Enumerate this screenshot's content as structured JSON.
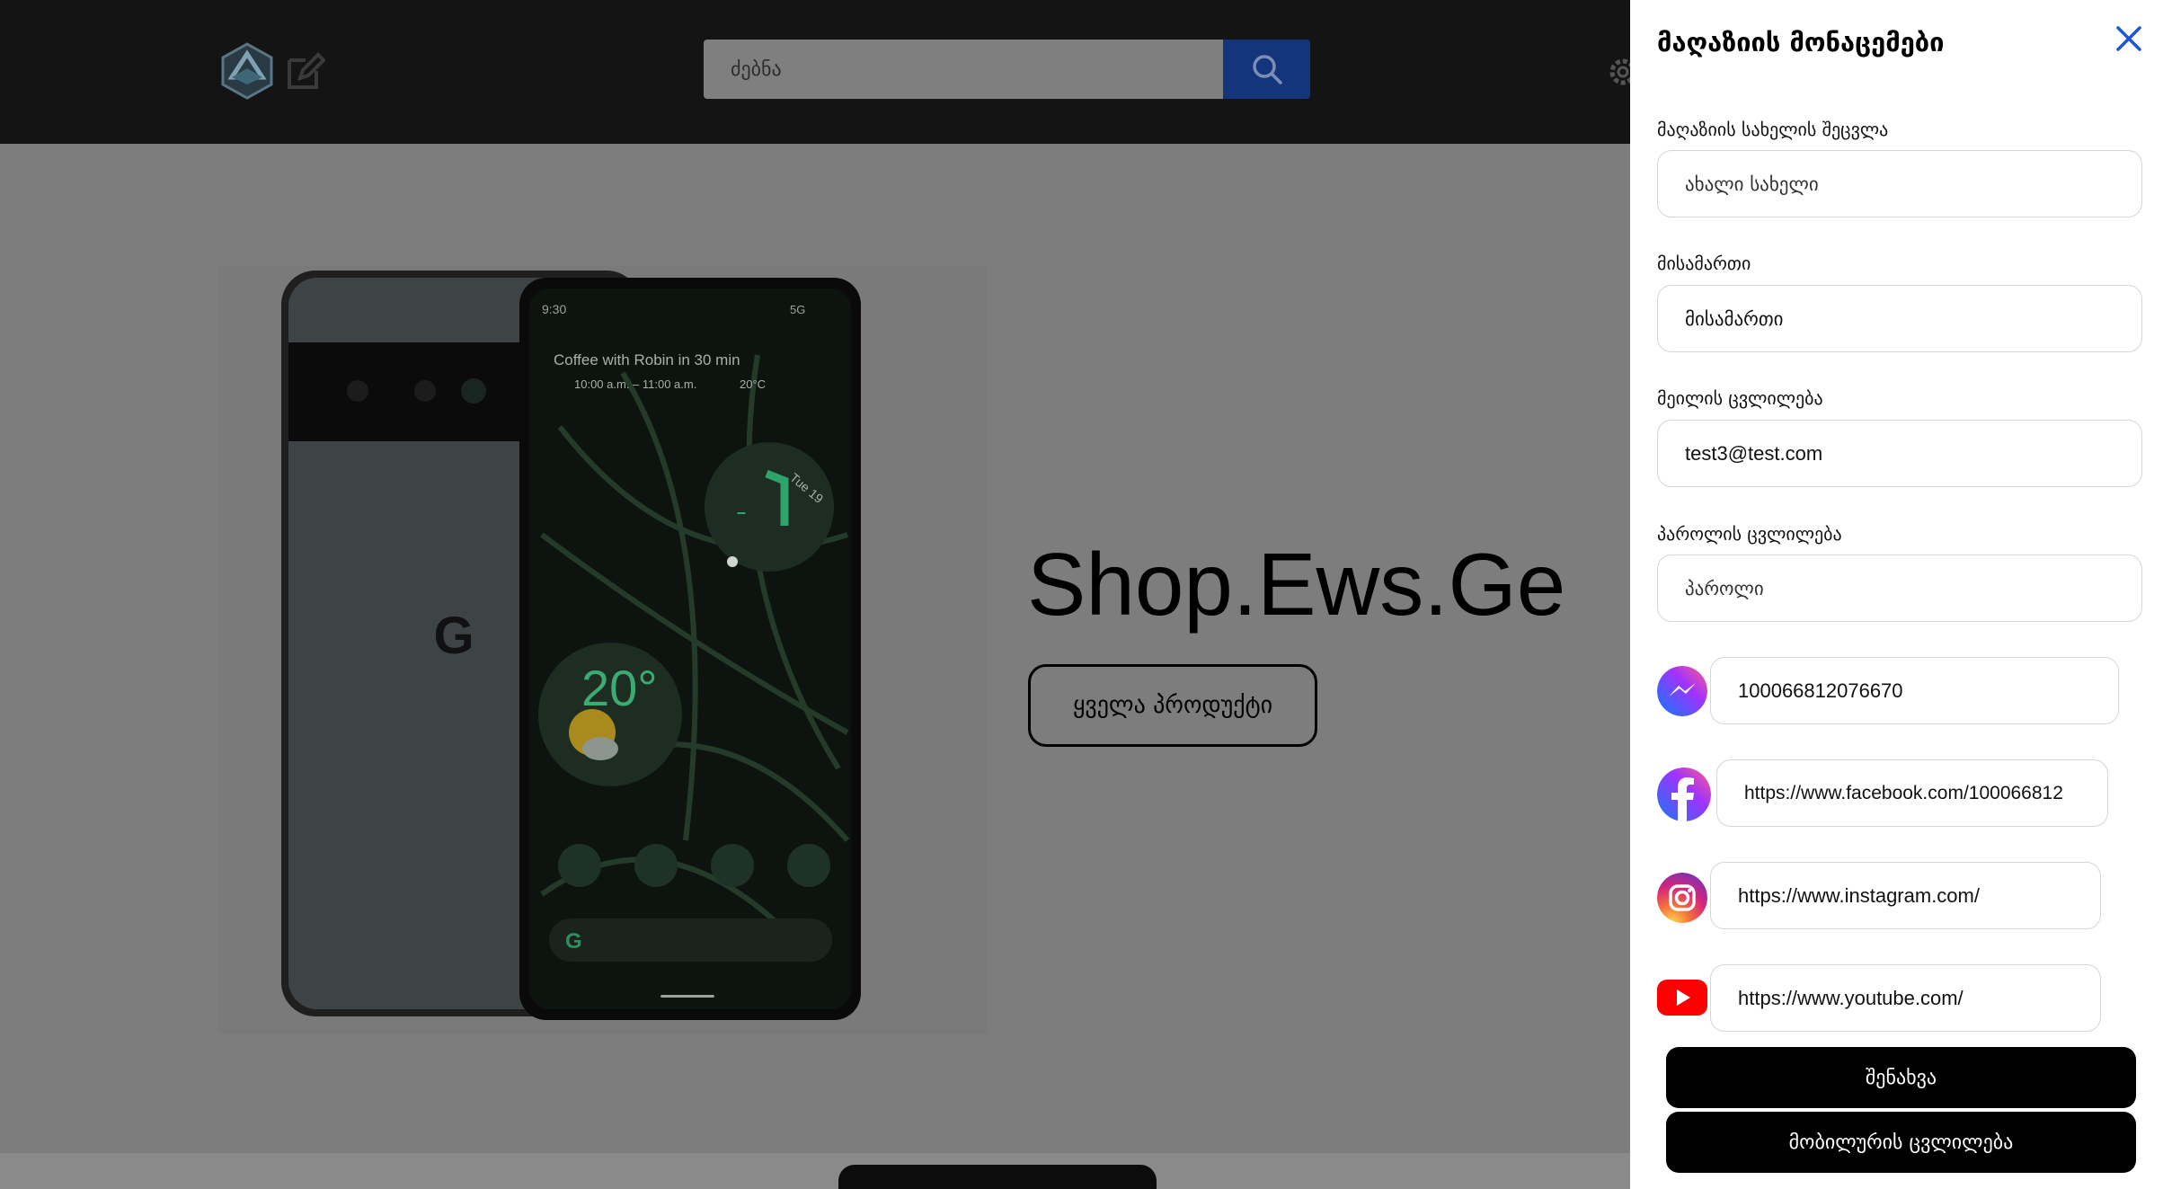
{
  "header": {
    "search_placeholder": "ძებნა"
  },
  "hero": {
    "title": "Shop.Ews.Ge",
    "cta_label": "ყველა პროდუქტი"
  },
  "phone_screen": {
    "time": "9:30",
    "signal": "5G",
    "event_title": "Coffee with Robin in 30 min",
    "event_time": "10:00 a.m. – 11:00 a.m.",
    "event_temp": "20°C",
    "date": "Tue 19",
    "weather_temp": "20°"
  },
  "panel": {
    "title": "მაღაზიის მონაცემები",
    "fields": [
      {
        "label": "მაღაზიის სახელის შეცვლა",
        "value": "",
        "placeholder": "ახალი სახელი"
      },
      {
        "label": "მისამართი",
        "value": "მისამართი",
        "placeholder": ""
      },
      {
        "label": "მეილის ცვლილება",
        "value": "test3@test.com",
        "placeholder": ""
      },
      {
        "label": "პაროლის ცვლილება",
        "value": "",
        "placeholder": "პაროლი"
      }
    ],
    "social": {
      "messenger": "100066812076670",
      "facebook": "https://www.facebook.com/100066812",
      "instagram": "https://www.instagram.com/",
      "youtube": "https://www.youtube.com/"
    },
    "save_label": "შენახვა",
    "mobile_label": "მობილურის ცვლილება"
  },
  "colors": {
    "topbar": "#141414",
    "search_button": "#14357a",
    "panel_bg": "#ffffff",
    "close_icon": "#1a56db",
    "button_black": "#000000"
  }
}
